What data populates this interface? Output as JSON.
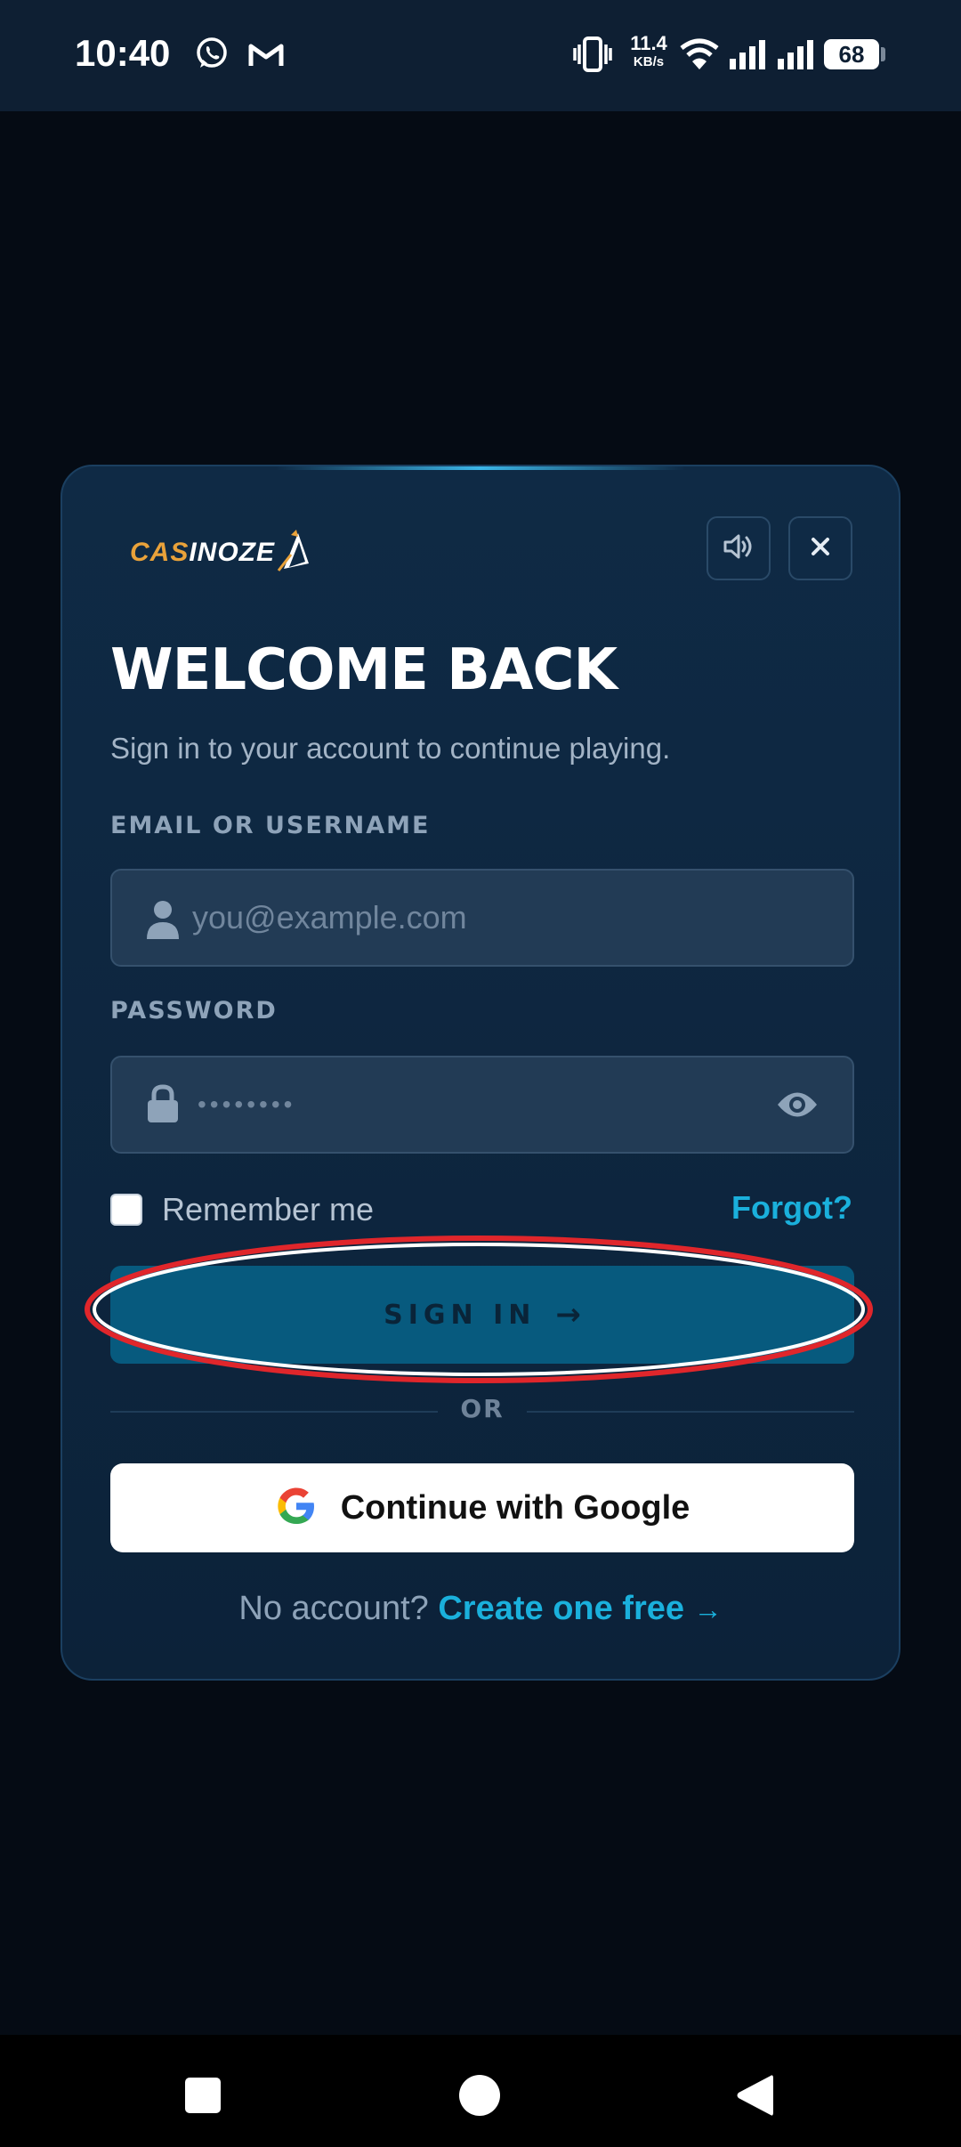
{
  "status_bar": {
    "time": "10:40",
    "net_speed_value": "11.4",
    "net_speed_unit": "KB/s",
    "battery": "68",
    "icons": [
      "whatsapp-icon",
      "gmail-icon",
      "vibrate-icon",
      "wifi-icon",
      "signal-icon",
      "signal-icon",
      "battery-icon"
    ]
  },
  "modal": {
    "logo": {
      "part1": "CAS",
      "part2": "INOZE"
    },
    "sound_icon": "speaker-icon",
    "close_icon": "close-icon",
    "title": "WELCOME BACK",
    "subtitle": "Sign in to your account to continue playing.",
    "email": {
      "label": "EMAIL OR USERNAME",
      "placeholder": "you@example.com",
      "icon": "user-icon"
    },
    "password": {
      "label": "PASSWORD",
      "masked_value": "••••••••",
      "icon": "lock-icon",
      "toggle_icon": "eye-icon"
    },
    "remember_label": "Remember me",
    "forgot_label": "Forgot?",
    "signin": {
      "label": "SIGN IN",
      "arrow": "→"
    },
    "or_label": "OR",
    "google": {
      "label": "Continue with Google",
      "icon": "google-icon"
    },
    "footer": {
      "prompt": "No account?",
      "link": "Create one free",
      "arrow": "→"
    }
  },
  "colors": {
    "accent": "#1ab0dc",
    "signin_button": "#075a7e",
    "annotation_ring": "#e0262b",
    "logo_gold": "#e9a23a"
  },
  "nav_bar": {
    "icons": [
      "recents-square-icon",
      "home-circle-icon",
      "back-triangle-icon"
    ]
  }
}
